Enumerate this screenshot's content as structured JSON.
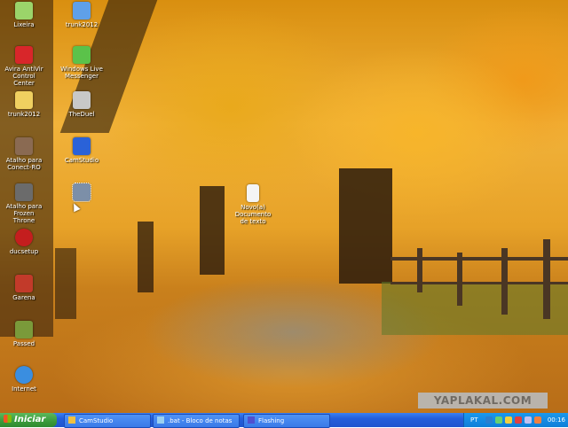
{
  "desktop": {
    "icons": [
      {
        "label": "Lixeira",
        "color": "#9bd46a"
      },
      {
        "label": "trunk2012",
        "color": "#5fa0e8"
      },
      {
        "label": "Avira AntiVir Control\nCenter",
        "color": "#d8262a"
      },
      {
        "label": "Windows Live\nMessenger",
        "color": "#5bc24a"
      },
      {
        "label": "trunk2012",
        "color": "#f0d060"
      },
      {
        "label": "TheDuel",
        "color": "#c8c8c8"
      },
      {
        "label": "Atalho para\nConect-RO",
        "color": "#8a6a52"
      },
      {
        "label": "CamStudio",
        "color": "#2a62d8"
      },
      {
        "label": "Atalho para Frozen\nThrone",
        "color": "#6b6b6b"
      },
      {
        "label": "Novo(a) Documento\nde texto",
        "color": "#f4f4f4"
      },
      {
        "label": "ducsetup",
        "color": "#c41e1e"
      },
      {
        "label": "Garena",
        "color": "#c23a2a"
      },
      {
        "label": "Passed",
        "color": "#7a9a3a"
      },
      {
        "label": "Internet",
        "color": "#3a8ee0"
      }
    ],
    "selected_icon": {
      "color": "#7c8fa8"
    },
    "watermark": "YAPLAKAL.COM"
  },
  "taskbar": {
    "start_label": "Iniciar",
    "tasks": [
      {
        "label": "CamStudio",
        "icon_color": "#f0c040"
      },
      {
        "label": ".bat - Bloco de notas",
        "icon_color": "#9ad0f0"
      },
      {
        "label": "Flashing",
        "icon_color": "#5050d0"
      }
    ],
    "tray": {
      "language": "PT",
      "icon_colors": [
        "#2a7fd0",
        "#6ad070",
        "#f0d040",
        "#e04040",
        "#c0c0f0",
        "#f08040"
      ],
      "clock": "00:16"
    }
  }
}
